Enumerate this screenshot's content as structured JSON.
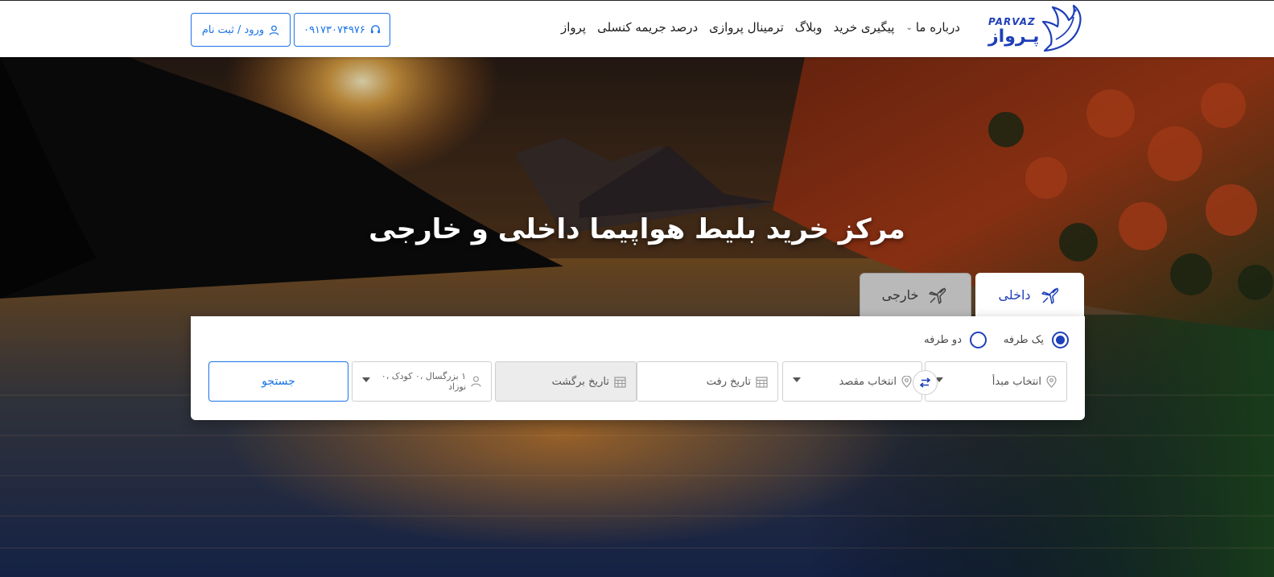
{
  "header": {
    "logo": {
      "latin": "PARVAZ",
      "persian": "پـرواز"
    },
    "nav": [
      {
        "label": "پرواز",
        "icon": ""
      },
      {
        "label": "درصد جریمه کنسلی",
        "icon": ""
      },
      {
        "label": "ترمینال پروازی",
        "icon": ""
      },
      {
        "label": "وبلاگ",
        "icon": ""
      },
      {
        "label": "پیگیری خرید",
        "icon": ""
      },
      {
        "label": "درباره ما",
        "icon": "chevron-down-icon"
      }
    ],
    "phone_button": {
      "label": "۰۹۱۷۳۰۷۴۹۷۶",
      "icon": "headset-icon"
    },
    "login_button": {
      "label": "ورود / ثبت نام",
      "icon": "user-icon"
    }
  },
  "hero": {
    "title": "مرکز خرید بلیط هواپیما داخلی و خارجی"
  },
  "tabs": {
    "domestic": {
      "label": "داخلی",
      "icon": "airplane-icon",
      "active": true
    },
    "international": {
      "label": "خارجی",
      "icon": "airplane-icon",
      "active": false
    }
  },
  "search": {
    "trip_types": {
      "one_way": "یک طرفه",
      "round_trip": "دو طرفه",
      "selected": "one_way"
    },
    "origin_placeholder": "انتخاب مبدأ",
    "destination_placeholder": "انتخاب مقصد",
    "depart_placeholder": "تاریخ رفت",
    "return_placeholder": "تاریخ برگشت",
    "passengers": "۱ بزرگسال ،۰ کودک ،۰ نوزاد",
    "search_button": "جستجو"
  },
  "colors": {
    "brand_blue": "#1f3fb8",
    "link_blue": "#1a73e8",
    "tab_inactive": "#b9b9b9",
    "return_disabled": "#ececec"
  }
}
